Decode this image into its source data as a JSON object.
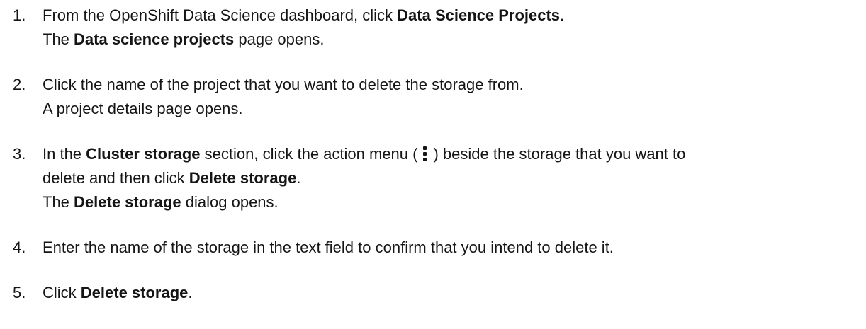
{
  "steps": [
    {
      "number": "1.",
      "line1": {
        "prefix": "From the OpenShift Data Science dashboard, click ",
        "bold": "Data Science Projects",
        "suffix": "."
      },
      "line2": {
        "prefix": "The ",
        "bold": "Data science projects",
        "suffix": " page opens."
      }
    },
    {
      "number": "2.",
      "line1": "Click the name of the project that you want to delete the storage from.",
      "line2": "A project details page opens."
    },
    {
      "number": "3.",
      "line1": {
        "prefix": "In the ",
        "bold": "Cluster storage",
        "middle": " section, click the action menu (",
        "icon": "kebab-vertical-icon",
        "suffix": ") beside the storage that you want to"
      },
      "line2": {
        "prefix": "delete and then click ",
        "bold": "Delete storage",
        "suffix": "."
      },
      "line3": {
        "prefix": "The ",
        "bold": "Delete storage",
        "suffix": " dialog opens."
      }
    },
    {
      "number": "4.",
      "line1": "Enter the name of the storage in the text field to confirm that you intend to delete it."
    },
    {
      "number": "5.",
      "line1": {
        "prefix": "Click ",
        "bold": "Delete storage",
        "suffix": "."
      }
    }
  ]
}
